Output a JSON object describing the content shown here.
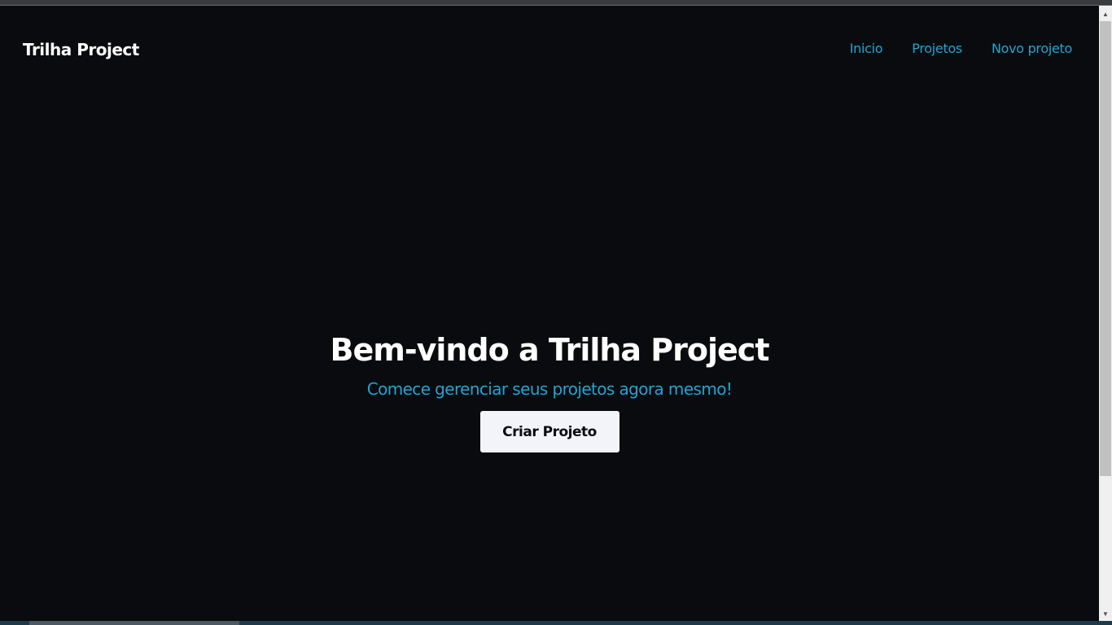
{
  "header": {
    "brand": "Trilha Project",
    "nav": [
      {
        "label": "Inicio"
      },
      {
        "label": "Projetos"
      },
      {
        "label": "Novo projeto"
      }
    ]
  },
  "hero": {
    "title": "Bem-vindo a Trilha Project",
    "subtitle": "Comece gerenciar seus projetos agora mesmo!",
    "cta_label": "Criar Projeto"
  },
  "colors": {
    "background": "#0a0b0e",
    "accent": "#1ea6d4",
    "button_bg": "#f2f4fa",
    "text": "#ffffff"
  }
}
